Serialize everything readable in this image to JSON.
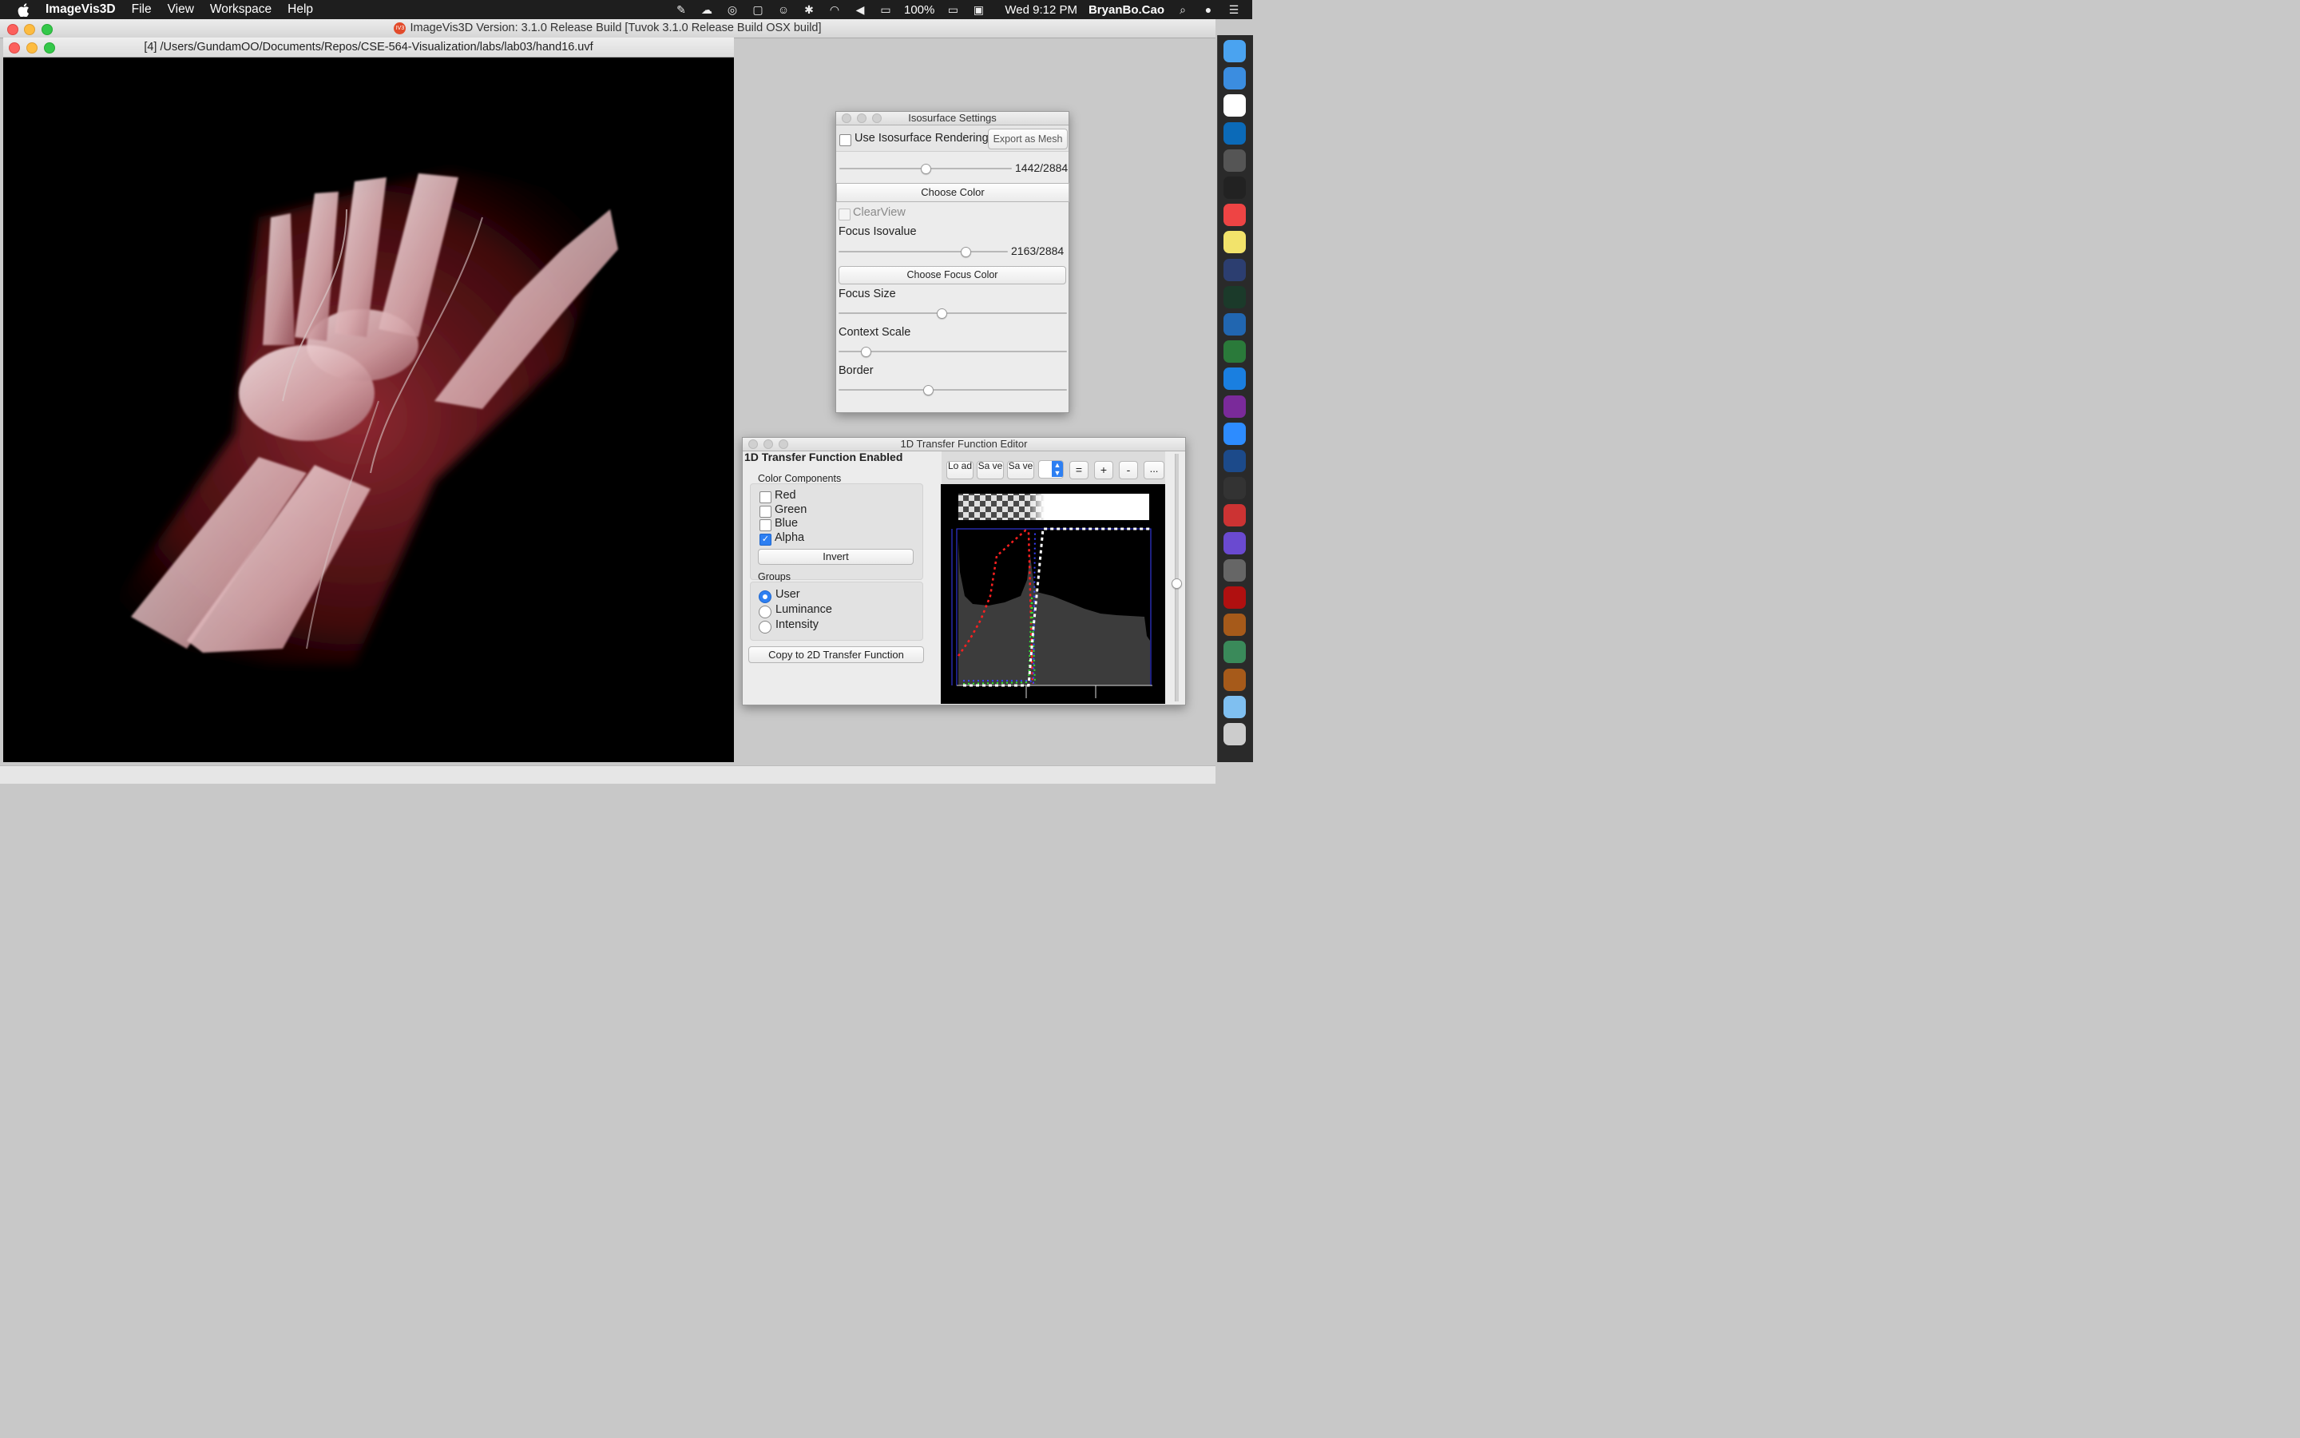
{
  "menubar": {
    "apple": "",
    "app_name": "ImageVis3D",
    "items": [
      "File",
      "View",
      "Workspace",
      "Help"
    ],
    "battery": "100%",
    "clock": "Wed 9:12 PM",
    "user": "BryanBo.Cao"
  },
  "main_window": {
    "title": "ImageVis3D Version: 3.1.0 Release Build [Tuvok 3.1.0 Release Build OSX build]",
    "logo_text": "IV3"
  },
  "render_window": {
    "title": "[4] /Users/GundamOO/Documents/Repos/CSE-564-Visualization/labs/lab03/hand16.uvf"
  },
  "isosurface": {
    "title": "Isosurface Settings",
    "use_label": "Use Isosurface Rendering",
    "export_label": "Export as Mesh",
    "iso_value": "1442/2884",
    "iso_fraction": 0.5,
    "choose_color": "Choose Color",
    "clearview_label": "ClearView",
    "focus_isovalue_label": "Focus Isovalue",
    "focus_value": "2163/2884",
    "focus_fraction": 0.75,
    "choose_focus_color": "Choose Focus Color",
    "focus_size_label": "Focus Size",
    "focus_size_fraction": 0.45,
    "context_scale_label": "Context Scale",
    "context_scale_fraction": 0.12,
    "border_label": "Border",
    "border_fraction": 0.39
  },
  "tf_editor": {
    "title": "1D Transfer Function Editor",
    "enabled_label": "1D Transfer Function Enabled",
    "color_components_label": "Color Components",
    "components": [
      {
        "label": "Red",
        "checked": false
      },
      {
        "label": "Green",
        "checked": false
      },
      {
        "label": "Blue",
        "checked": false
      },
      {
        "label": "Alpha",
        "checked": true
      }
    ],
    "invert_label": "Invert",
    "groups_label": "Groups",
    "groups": [
      {
        "label": "User",
        "selected": true
      },
      {
        "label": "Luminance",
        "selected": false
      },
      {
        "label": "Intensity",
        "selected": false
      }
    ],
    "copy_label": "Copy to 2D Transfer Function",
    "toolbar": {
      "load": "Lo ad",
      "save1": "Sa ve",
      "save2": "Sa ve",
      "eq": "=",
      "plus": "+",
      "minus": "-",
      "more": "..."
    }
  },
  "colors": {
    "render_bg": "#000000",
    "menubar_bg": "#1e1e1e",
    "accent": "#2d7ff2",
    "red_curve": "#ff2020",
    "alpha_curve": "#ffffff",
    "histogram": "#3c3c3c"
  },
  "dock": [
    "finder-icon",
    "pen-app-icon",
    "calendar-icon",
    "outlook-icon",
    "launchpad-icon",
    "terminal-icon",
    "chrome-icon",
    "notes-icon",
    "eclipse-icon",
    "activity-monitor-icon",
    "r-icon",
    "app-icon",
    "teamviewer-icon",
    "onenote-icon",
    "zoom-icon",
    "quicktime-icon",
    "keynote-icon",
    "app2-icon",
    "color-icon",
    "system-preferences-icon",
    "acrobat-icon",
    "imagevis-icon",
    "atom-icon",
    "imagevis2-icon",
    "folder-icon",
    "trash-icon"
  ]
}
